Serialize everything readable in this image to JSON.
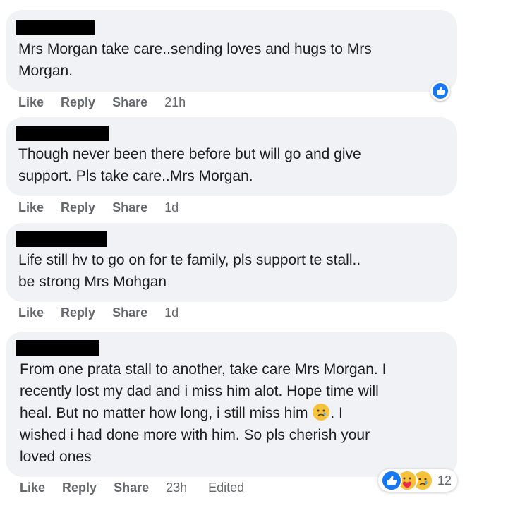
{
  "comments": [
    {
      "text": "Mrs Morgan take care..sending loves and hugs to Mrs\nMorgan.",
      "actions": {
        "like": "Like",
        "reply": "Reply",
        "share": "Share",
        "time": "21h"
      }
    },
    {
      "text": "Though never been there before but will go and give\nsupport. Pls take care..Mrs Morgan.",
      "actions": {
        "like": "Like",
        "reply": "Reply",
        "share": "Share",
        "time": "1d"
      }
    },
    {
      "text": "Life still hv to go on for te family, pls support te stall..\nbe strong Mrs Mohgan",
      "actions": {
        "like": "Like",
        "reply": "Reply",
        "share": "Share",
        "time": "1d"
      }
    },
    {
      "text_part1": "From one prata stall to another, take care Mrs Morgan. I\nrecently lost my dad and i miss him alot. Hope time will\nheal. But no matter how long, i still miss him ",
      "text_part2": ". I\nwished i had done more with him. So pls cherish your\nloved ones",
      "actions": {
        "like": "Like",
        "reply": "Reply",
        "share": "Share",
        "time": "23h",
        "edited": "Edited"
      },
      "reaction_count": "12"
    }
  ],
  "colors": {
    "bubble": "#f0f2f5",
    "like_blue": "#1877f2",
    "emoji_yellow": "#f7c23b",
    "muted_text": "#65676b"
  }
}
